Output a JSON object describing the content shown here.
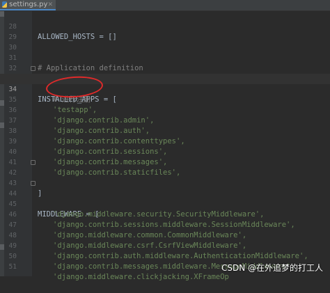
{
  "tab": {
    "filename": "settings.py"
  },
  "lines": [
    {
      "num": "28",
      "text": "ALLOWED_HOSTS = []"
    },
    {
      "num": "29",
      "text": ""
    },
    {
      "num": "30",
      "text": ""
    },
    {
      "num": "31",
      "text": "# Application definition"
    },
    {
      "num": "32",
      "text": ""
    },
    {
      "num": "33",
      "text": "INSTALLED_APPS = ["
    },
    {
      "num": "34",
      "text": "# 进行注册"
    },
    {
      "num": "35",
      "text": "'testapp',"
    },
    {
      "num": "36",
      "text": "'django.contrib.admin',"
    },
    {
      "num": "37",
      "text": "'django.contrib.auth',"
    },
    {
      "num": "38",
      "text": "'django.contrib.contenttypes',"
    },
    {
      "num": "39",
      "text": "'django.contrib.sessions',"
    },
    {
      "num": "40",
      "text": "'django.contrib.messages',"
    },
    {
      "num": "41",
      "text": "'django.contrib.staticfiles',"
    },
    {
      "num": "42",
      "text": "]"
    },
    {
      "num": "43",
      "text": ""
    },
    {
      "num": "44",
      "text": "MIDDLEWARE = ["
    },
    {
      "num": "45",
      "text": "'django.middleware.security.SecurityMiddleware',"
    },
    {
      "num": "46",
      "text": "'django.contrib.sessions.middleware.SessionMiddleware',"
    },
    {
      "num": "47",
      "text": "'django.middleware.common.CommonMiddleware',"
    },
    {
      "num": "48",
      "text": "'django.middleware.csrf.CsrfViewMiddleware',"
    },
    {
      "num": "49",
      "text": "'django.contrib.auth.middleware.AuthenticationMiddleware',"
    },
    {
      "num": "50",
      "text": "'django.contrib.messages.middleware.MessageMiddleware',"
    },
    {
      "num": "51",
      "text": "'django.middleware.clickjacking.XFrameOp"
    }
  ],
  "watermark": "CSDN @在外追梦的打工人",
  "colors": {
    "background": "#2b2b2b",
    "string": "#6a8759",
    "comment": "#808080",
    "annotation_circle": "#e02a2a"
  }
}
